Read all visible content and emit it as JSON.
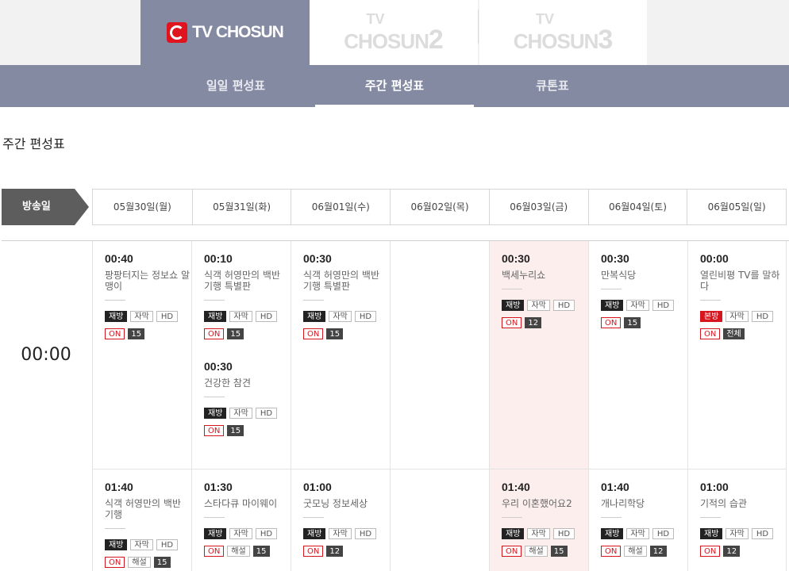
{
  "channels": {
    "main": "TV CHOSUN",
    "ch2_tv": "TV",
    "ch2_name": "CHOSUN",
    "ch2_num": "2",
    "ch3_tv": "TV",
    "ch3_name": "CHOSUN",
    "ch3_num": "3"
  },
  "subnav": {
    "daily": "일일 편성표",
    "weekly": "주간 편성표",
    "cue": "큐톤표"
  },
  "page_title": "주간 편성표",
  "broadcast_day_label": "방송일",
  "dates": [
    "05월30일(월)",
    "05월31일(화)",
    "06월01일(수)",
    "06월02일(목)",
    "06월03일(금)",
    "06월04일(토)",
    "06월05일(일)"
  ],
  "hours": [
    "00:00"
  ],
  "programs": {
    "p1": {
      "time": "00:40",
      "title": "팡팡터지는 정보쇼 알맹이",
      "b1": "재방",
      "b2": "자막",
      "b3": "HD",
      "b4": "ON",
      "rating": "15"
    },
    "p2": {
      "time": "00:10",
      "title": "식객 허영만의 백반 기행 특별판",
      "b1": "재방",
      "b2": "자막",
      "b3": "HD",
      "b4": "ON",
      "rating": "15"
    },
    "p3": {
      "time": "00:30",
      "title": "건강한 참견",
      "b1": "재방",
      "b2": "자막",
      "b3": "HD",
      "b4": "ON",
      "rating": "15"
    },
    "p4": {
      "time": "00:30",
      "title": "식객 허영만의 백반 기행 특별판",
      "b1": "재방",
      "b2": "자막",
      "b3": "HD",
      "b4": "ON",
      "rating": "15"
    },
    "p5": {
      "time": "00:30",
      "title": "백세누리쇼",
      "b1": "재방",
      "b2": "자막",
      "b3": "HD",
      "b4": "ON",
      "rating": "12"
    },
    "p6": {
      "time": "00:30",
      "title": "만복식당",
      "b1": "재방",
      "b2": "자막",
      "b3": "HD",
      "b4": "ON",
      "rating": "15"
    },
    "p7": {
      "time": "00:00",
      "title": "열린비평 TV를 말하다",
      "b1": "본방",
      "b2": "자막",
      "b3": "HD",
      "b4": "ON",
      "rating": "전체"
    },
    "p8": {
      "time": "01:40",
      "title": "식객 허영만의 백반 기행",
      "b1": "재방",
      "b2": "자막",
      "b3": "HD",
      "b4": "ON",
      "b5": "해설",
      "rating": "15"
    },
    "p9": {
      "time": "01:30",
      "title": "스타다큐 마이웨이",
      "b1": "재방",
      "b2": "자막",
      "b3": "HD",
      "b4": "ON",
      "b5": "해설",
      "rating": "15"
    },
    "p10": {
      "time": "01:00",
      "title": "굿모닝 정보세상",
      "b1": "재방",
      "b2": "자막",
      "b3": "HD",
      "b4": "ON",
      "rating": "12"
    },
    "p11": {
      "time": "01:40",
      "title": "우리 이혼했어요2",
      "b1": "재방",
      "b2": "자막",
      "b3": "HD",
      "b4": "ON",
      "b5": "해설",
      "rating": "15"
    },
    "p12": {
      "time": "01:40",
      "title": "개나리학당",
      "b1": "재방",
      "b2": "자막",
      "b3": "HD",
      "b4": "ON",
      "b5": "해설",
      "rating": "12"
    },
    "p13": {
      "time": "01:00",
      "title": "기적의 습관",
      "b1": "재방",
      "b2": "자막",
      "b3": "HD",
      "b4": "ON",
      "rating": "12"
    }
  },
  "colors": {
    "nav": "#858aa3",
    "highlight": "#fdeeee",
    "on_red": "#d7151f"
  }
}
